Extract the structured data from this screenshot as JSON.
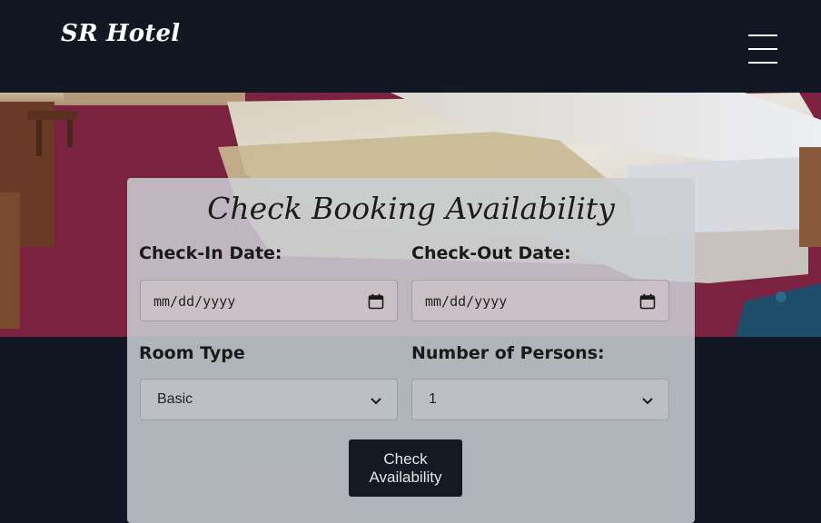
{
  "brand": "SR Hotel",
  "form": {
    "title": "Check Booking Availability",
    "checkin_label": "Check-In Date:",
    "checkin_value": "mm/dd/yyyy",
    "checkout_label": "Check-Out Date:",
    "checkout_value": "mm/dd/yyyy",
    "room_type_label": "Room Type",
    "room_type_value": "Basic",
    "persons_label": "Number of Persons:",
    "persons_value": "1",
    "submit_line1": "Check",
    "submit_line2": "Availability"
  },
  "icons": {
    "menu": "hamburger-menu-icon",
    "calendar": "calendar-icon",
    "dropdown": "chevron-down-icon"
  },
  "colors": {
    "navbar": "#111823",
    "button": "#141a24",
    "card": "#cbcfd4"
  }
}
